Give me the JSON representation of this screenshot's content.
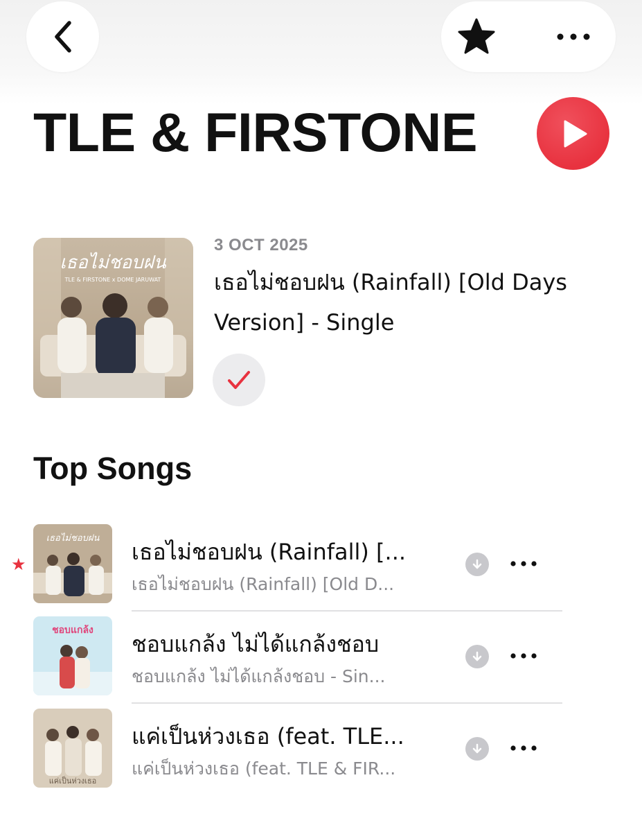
{
  "header": {
    "back_icon": "chevron-left-icon",
    "favorite_icon": "star-icon",
    "more_icon": "ellipsis-icon"
  },
  "artist": {
    "name": "TLE & FIRSTONE",
    "play_icon": "play-icon",
    "accent_color": "#e8323f"
  },
  "latest_release": {
    "date": "3 OCT 2025",
    "title": "เธอไม่ชอบฝน (Rainfall) [Old Days Version] - Single",
    "art_text": "เธอไม่ชอบฝน",
    "art_subtext": "TLE & FIRSTONE x DOME JARUWAT",
    "added_icon": "checkmark-icon"
  },
  "top_songs": {
    "heading": "Top Songs",
    "items": [
      {
        "title": "เธอไม่ชอบฝน (Rainfall) [...",
        "subtitle": "เธอไม่ชอบฝน (Rainfall) [Old D...",
        "favorite": true,
        "art_text": "เธอไม่ชอบฝน"
      },
      {
        "title": "ชอบแกล้ง ไม่ได้แกล้งชอบ",
        "subtitle": "ชอบแกล้ง ไม่ได้แกล้งชอบ - Sin...",
        "favorite": false,
        "art_text": "ชอบแกล้ง"
      },
      {
        "title": "แค่เป็นห่วงเธอ (feat. TLE...",
        "subtitle": "แค่เป็นห่วงเธอ (feat. TLE & FIR...",
        "favorite": false,
        "art_text": "แค่เป็นห่วงเธอ"
      }
    ]
  }
}
